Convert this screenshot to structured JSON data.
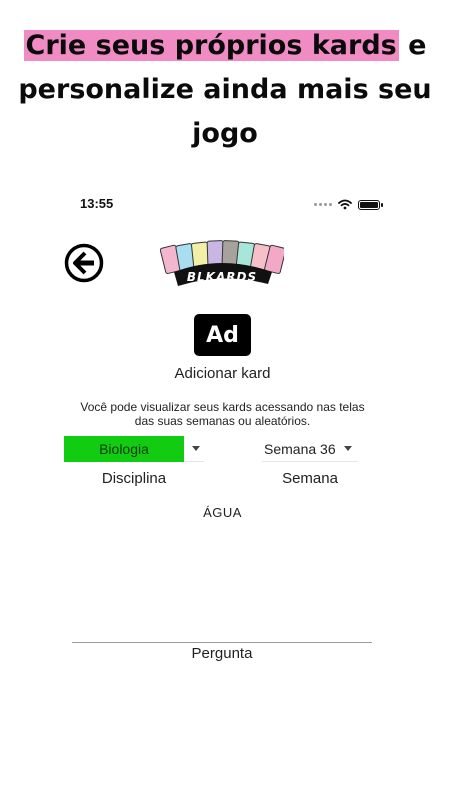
{
  "headline": {
    "highlight": "Crie seus próprios kards",
    "rest": " e personalize ainda mais seu jogo",
    "highlight_color": "#f08cc3"
  },
  "status_bar": {
    "time": "13:55",
    "icons": [
      "signal-icon",
      "wifi-icon",
      "battery-icon"
    ]
  },
  "header": {
    "back_icon": "arrow-left-circle-icon",
    "logo_text": "BLKARDS",
    "logo_card_colors": [
      "#f4b6cf",
      "#a9def0",
      "#f2f0a6",
      "#c9b6e4",
      "#a7a39c",
      "#a8e6da",
      "#f6c0c9",
      "#f3a9c6"
    ]
  },
  "add_card": {
    "icon_text": "Ad",
    "label": "Adicionar kard"
  },
  "info": {
    "line1": "Você pode visualizar seus kards acessando nas telas",
    "line2": "das suas semanas ou aleatórios."
  },
  "filters": {
    "discipline": {
      "value": "Biologia",
      "label": "Disciplina",
      "color": "#11cc11"
    },
    "week": {
      "value": "Semana 36",
      "label": "Semana"
    }
  },
  "card": {
    "answer": "ÁGUA",
    "question_label": "Pergunta"
  }
}
